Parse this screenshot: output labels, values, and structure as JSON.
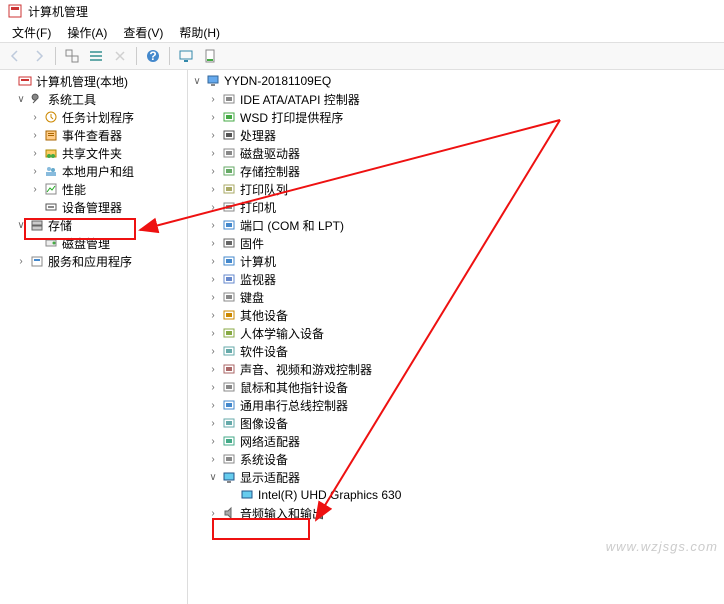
{
  "window": {
    "title": "计算机管理"
  },
  "menu": {
    "file": "文件(F)",
    "action": "操作(A)",
    "view": "查看(V)",
    "help": "帮助(H)"
  },
  "left": {
    "root": "计算机管理(本地)",
    "system_tools": "系统工具",
    "task_scheduler": "任务计划程序",
    "event_viewer": "事件查看器",
    "shared_folders": "共享文件夹",
    "local_users": "本地用户和组",
    "performance": "性能",
    "device_manager": "设备管理器",
    "storage": "存储",
    "disk_mgmt": "磁盘管理",
    "services_apps": "服务和应用程序"
  },
  "right": {
    "root": "YYDN-20181109EQ",
    "items": [
      "IDE ATA/ATAPI 控制器",
      "WSD 打印提供程序",
      "处理器",
      "磁盘驱动器",
      "存储控制器",
      "打印队列",
      "打印机",
      "端口 (COM 和 LPT)",
      "固件",
      "计算机",
      "监视器",
      "键盘",
      "其他设备",
      "人体学输入设备",
      "软件设备",
      "声音、视频和游戏控制器",
      "鼠标和其他指针设备",
      "通用串行总线控制器",
      "图像设备",
      "网络适配器",
      "系统设备"
    ],
    "display_adapters": "显示适配器",
    "gpu": "Intel(R) UHD Graphics 630",
    "audio_io": "音频输入和输出"
  },
  "watermark": "www.wzjsgs.com"
}
